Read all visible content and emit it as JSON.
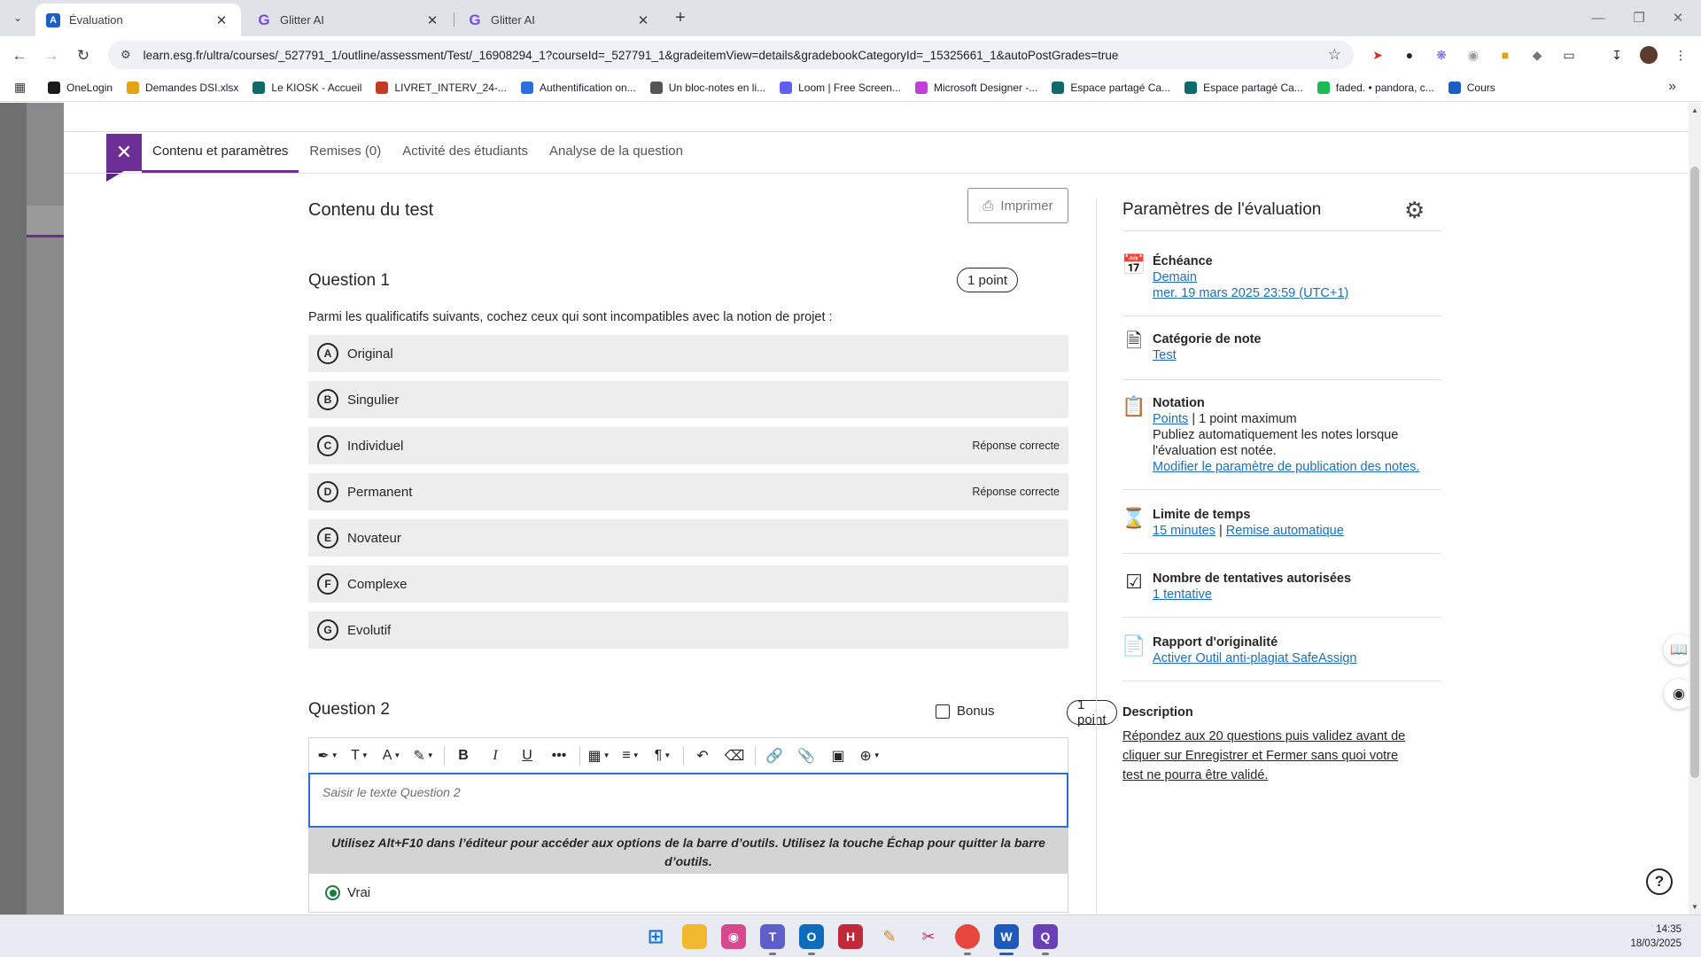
{
  "browser": {
    "tabs": [
      {
        "title": "Évaluation",
        "active": true,
        "favicon": "anthology-icon"
      },
      {
        "title": "Glitter AI",
        "active": false,
        "favicon": "glitter-icon"
      },
      {
        "title": "Glitter AI",
        "active": false,
        "favicon": "glitter-icon"
      }
    ],
    "url": "learn.esg.fr/ultra/courses/_527791_1/outline/assessment/Test/_16908294_1?courseId=_527791_1&gradeitemView=details&gradebookCategoryId=_15325661_1&autoPostGrades=true",
    "bookmarks": [
      {
        "label": "OneLogin",
        "color": "#1b1b1b"
      },
      {
        "label": "Demandes DSI.xlsx",
        "color": "#e2a412"
      },
      {
        "label": "Le KIOSK - Accueil",
        "color": "#0f6b6b"
      },
      {
        "label": "LIVRET_INTERV_24-...",
        "color": "#c23b22"
      },
      {
        "label": "Authentification on...",
        "color": "#2a6fdb"
      },
      {
        "label": "Un bloc-notes en li...",
        "color": "#555555"
      },
      {
        "label": "Loom | Free Screen...",
        "color": "#625df5"
      },
      {
        "label": "Microsoft Designer -...",
        "color": "#c03fd6"
      },
      {
        "label": "Espace partagé Ca...",
        "color": "#0f6b6b"
      },
      {
        "label": "Espace partagé Ca...",
        "color": "#0f6b6b"
      },
      {
        "label": "faded. • pandora, c...",
        "color": "#1db954"
      },
      {
        "label": "Cours",
        "color": "#1b5ec5"
      }
    ]
  },
  "panel": {
    "tabs": [
      {
        "label": "Contenu et paramètres",
        "active": true
      },
      {
        "label": "Remises (0)",
        "active": false
      },
      {
        "label": "Activité des étudiants",
        "active": false
      },
      {
        "label": "Analyse de la question",
        "active": false
      }
    ]
  },
  "test": {
    "title": "Contenu du test",
    "print_label": "Imprimer",
    "question1": {
      "title": "Question 1",
      "points": "1 point",
      "text": "Parmi les qualificatifs suivants, cochez ceux qui sont incompatibles avec la notion de projet :",
      "options": [
        {
          "letter": "A",
          "text": "Original",
          "correct": ""
        },
        {
          "letter": "B",
          "text": "Singulier",
          "correct": ""
        },
        {
          "letter": "C",
          "text": "Individuel",
          "correct": "Réponse correcte"
        },
        {
          "letter": "D",
          "text": "Permanent",
          "correct": "Réponse correcte"
        },
        {
          "letter": "E",
          "text": "Novateur",
          "correct": ""
        },
        {
          "letter": "F",
          "text": "Complexe",
          "correct": ""
        },
        {
          "letter": "G",
          "text": "Evolutif",
          "correct": ""
        }
      ]
    },
    "question2": {
      "title": "Question 2",
      "bonus_label": "Bonus",
      "points": "1 point",
      "placeholder": "Saisir le texte Question 2",
      "hint": "Utilisez Alt+F10 dans l’éditeur pour accéder aux options de la barre d’outils. Utilisez la touche Échap pour quitter la barre d’outils.",
      "answer_label": "Vrai"
    }
  },
  "settings": {
    "title": "Paramètres de l'évaluation",
    "echeance": {
      "label": "Échéance",
      "line1": "Demain",
      "line2": "mer. 19 mars 2025 23:59 (UTC+1)"
    },
    "categorie": {
      "label": "Catégorie de note",
      "value": "Test"
    },
    "notation": {
      "label": "Notation",
      "link": "Points",
      "max": "| 1 point maximum",
      "text": "Publiez automatiquement les notes lorsque l'évaluation est notée.",
      "modify": "Modifier le paramètre de publication des notes."
    },
    "limite": {
      "label": "Limite de temps",
      "duration": "15 minutes",
      "sep": "|",
      "auto": "Remise automatique"
    },
    "tentatives": {
      "label": "Nombre de tentatives autorisées",
      "value": "1 tentative"
    },
    "originalite": {
      "label": "Rapport d'originalité",
      "value": "Activer Outil anti-plagiat SafeAssign"
    },
    "description": {
      "label": "Description",
      "text": "Répondez aux 20 questions puis validez avant de cliquer sur Enregistrer et Fermer sans quoi votre test ne pourra être validé."
    }
  },
  "taskbar": {
    "time": "14:35",
    "date": "18/03/2025"
  },
  "colors": {
    "accent_purple": "#6d2f95",
    "link_blue": "#1c6fb8",
    "focus_blue": "#2f6fd1"
  }
}
